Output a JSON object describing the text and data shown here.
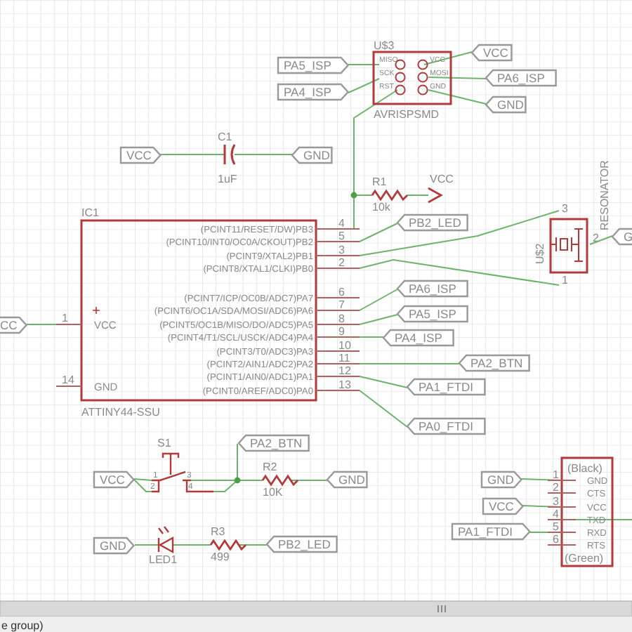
{
  "net_labels": [
    {
      "text": "PA5_ISP"
    },
    {
      "text": "PA4_ISP"
    },
    {
      "text": "VCC"
    },
    {
      "text": "PA6_ISP"
    },
    {
      "text": "GND"
    },
    {
      "text": "VCC"
    },
    {
      "text": "GND"
    },
    {
      "text": "PB2_LED"
    },
    {
      "text": "G"
    },
    {
      "text": "PA6_ISP"
    },
    {
      "text": "PA5_ISP"
    },
    {
      "text": "PA4_ISP"
    },
    {
      "text": "PA2_BTN"
    },
    {
      "text": "PA1_FTDI"
    },
    {
      "text": "PA0_FTDI"
    },
    {
      "text": "CC"
    },
    {
      "text": "PA2_BTN"
    },
    {
      "text": "VCC"
    },
    {
      "text": "GND"
    },
    {
      "text": "GND"
    },
    {
      "text": "PB2_LED"
    },
    {
      "text": "GND"
    },
    {
      "text": "VCC"
    },
    {
      "text": "PA1_FTDI"
    }
  ],
  "isp_header": {
    "name": "U$3",
    "value": "AVRISPSMD",
    "pins_left": [
      "MISO",
      "SCK",
      "RST"
    ],
    "pins_right": [
      "VCC",
      "MOSI",
      "GND"
    ]
  },
  "capacitor": {
    "name": "C1",
    "value": "1uF"
  },
  "resistors": [
    {
      "name": "R1",
      "value": "10k"
    },
    {
      "name": "R2",
      "value": "10K"
    },
    {
      "name": "R3",
      "value": "499"
    }
  ],
  "power_symbol": {
    "text": "VCC"
  },
  "mcu": {
    "name": "IC1",
    "value": "ATTINY44-SSU",
    "left_pins": [
      {
        "name": "VCC",
        "number": "1"
      },
      {
        "name": "GND",
        "number": "14"
      }
    ],
    "right_pins": [
      {
        "name": "(PCINT11/RESET/DW)PB3",
        "number": "4"
      },
      {
        "name": "(PCINT10/INT0/OC0A/CKOUT)PB2",
        "number": "5"
      },
      {
        "name": "(PCINT9/XTAL2)PB1",
        "number": "3"
      },
      {
        "name": "(PCINT8/XTAL1/CLKI)PB0",
        "number": "2"
      },
      {
        "name": "(PCINT7/ICP/OC0B/ADC7)PA7",
        "number": "6"
      },
      {
        "name": "(PCINT6/OC1A/SDA/MOSI/ADC6)PA6",
        "number": "7"
      },
      {
        "name": "(PCINT5/OC1B/MISO/DO/ADC5)PA5",
        "number": "8"
      },
      {
        "name": "(PCINT4/T1/SCL/USCK/ADC4)PA4",
        "number": "9"
      },
      {
        "name": "(PCINT3/T0/ADC3)PA3",
        "number": "10"
      },
      {
        "name": "(PCINT2/AIN1/ADC2)PA2",
        "number": "11"
      },
      {
        "name": "(PCINT1/AIN0/ADC1)PA1",
        "number": "12"
      },
      {
        "name": "(PCINT0/AREF/ADC0)PA0",
        "number": "13"
      }
    ]
  },
  "resonator": {
    "name": "U$2",
    "value": "RESONATOR",
    "pins": [
      "3",
      "2",
      "1"
    ]
  },
  "switch": {
    "name": "S1",
    "pins": [
      "1",
      "2",
      "3",
      "4"
    ]
  },
  "led": {
    "name": "LED1"
  },
  "ftdi_header": {
    "top": "(Black)",
    "bottom": "(Green)",
    "pins": [
      {
        "name": "GND",
        "number": "1"
      },
      {
        "name": "CTS",
        "number": "2"
      },
      {
        "name": "VCC",
        "number": "3"
      },
      {
        "name": "TXD",
        "number": "4"
      },
      {
        "name": "RXD",
        "number": "5"
      },
      {
        "name": "RTS",
        "number": "6"
      }
    ]
  },
  "status_bar": {
    "text": "e group)"
  }
}
